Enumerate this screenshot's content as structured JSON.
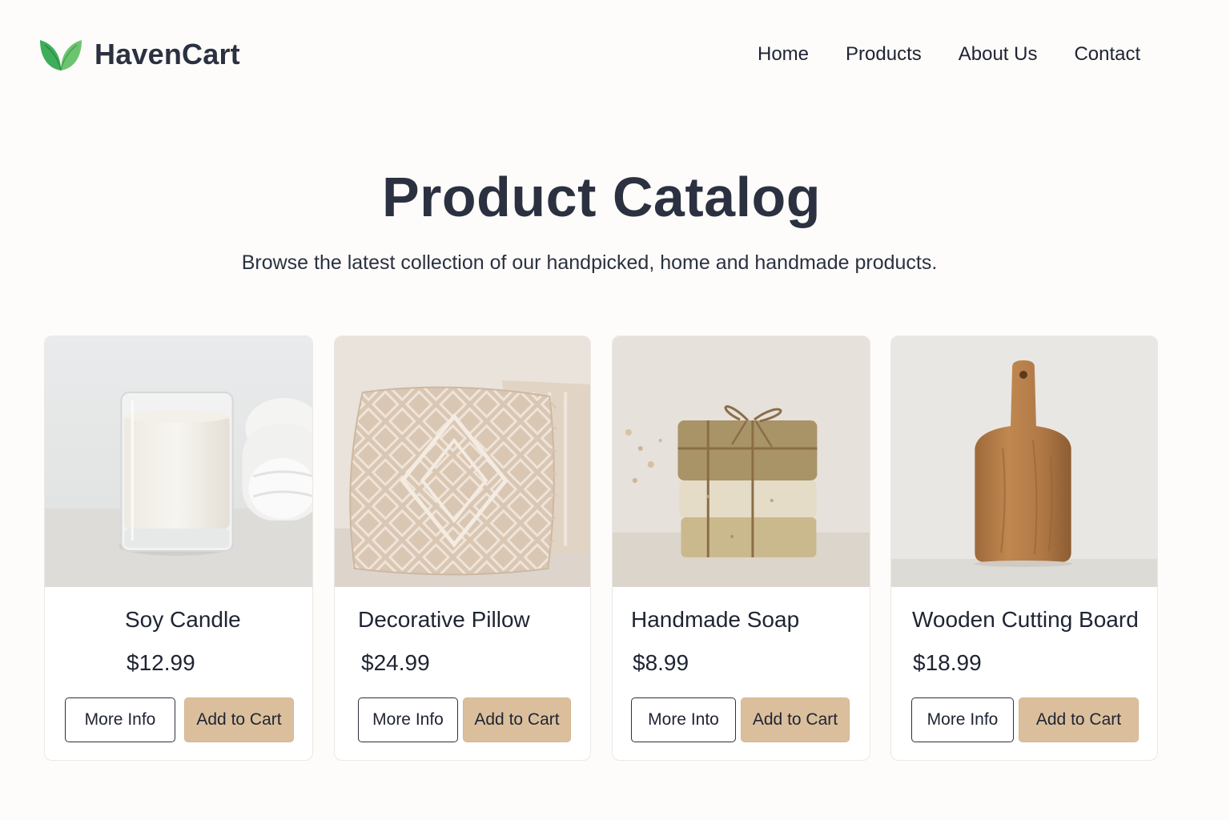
{
  "brand": {
    "name": "HavenCart",
    "logo_icon": "leaf-logo-icon",
    "accent": "#3fae5a"
  },
  "nav": {
    "items": [
      {
        "label": "Home"
      },
      {
        "label": "Products"
      },
      {
        "label": "About Us"
      },
      {
        "label": "Contact"
      }
    ]
  },
  "hero": {
    "title": "Product Catalog",
    "subtitle": "Browse the latest collection of our handpicked, home and handmade products."
  },
  "products": [
    {
      "name": "Soy Candle",
      "price": "$12.99",
      "more_label": "More Info",
      "cart_label": "Add to Cart",
      "image_icon": "candle-image"
    },
    {
      "name": "Decorative Pillow",
      "price": "$24.99",
      "more_label": "More Info",
      "cart_label": "Add to Cart",
      "image_icon": "pillow-image"
    },
    {
      "name": "Handmade Soap",
      "price": "$8.99",
      "more_label": "More Into",
      "cart_label": "Add to Cart",
      "image_icon": "soap-image"
    },
    {
      "name": "Wooden Cutting Board",
      "price": "$18.99",
      "more_label": "More Info",
      "cart_label": "Add to Cart",
      "image_icon": "cutting-board-image"
    }
  ],
  "colors": {
    "button_primary": "#dbbf9c",
    "text": "#1f2433",
    "background": "#fdfcfa"
  }
}
